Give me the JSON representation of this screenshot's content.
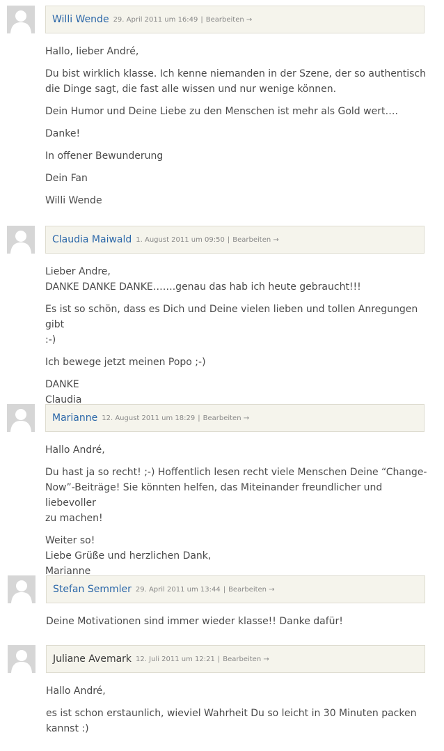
{
  "edit_label": "Bearbeiten →",
  "separator": "|",
  "comments": [
    {
      "author": "Willi Wende",
      "date": "29. April 2011 um 16:49",
      "paragraphs": [
        [
          "Hallo, lieber André,"
        ],
        [
          "Du bist wirklich klasse. Ich kenne niemanden in der Szene, der so authentisch",
          "die Dinge sagt, die fast alle wissen und nur wenige können."
        ],
        [
          "Dein Humor und Deine Liebe zu den Menschen ist mehr als Gold wert…."
        ],
        [
          "Danke!"
        ],
        [
          "In offener Bewunderung"
        ],
        [
          "Dein Fan"
        ],
        [
          "Willi Wende"
        ]
      ]
    },
    {
      "author": "Claudia Maiwald",
      "date": "1. August 2011 um 09:50",
      "paragraphs": [
        [
          "Lieber Andre,",
          "DANKE DANKE DANKE…….genau das hab ich heute gebraucht!!!"
        ],
        [
          "Es ist so schön, dass es Dich und Deine vielen lieben und tollen Anregungen gibt",
          ":-)"
        ],
        [
          "Ich bewege jetzt meinen Popo ;-)"
        ],
        [
          "DANKE",
          "Claudia"
        ]
      ]
    },
    {
      "author": "Marianne",
      "date": "12. August 2011 um 18:29",
      "paragraphs": [
        [
          "Hallo André,"
        ],
        [
          "Du hast ja so recht! ;-) Hoffentlich lesen recht viele Menschen Deine “Change-",
          "Now”-Beiträge! Sie könnten helfen, das Miteinander freundlicher und liebevoller",
          "zu machen!"
        ],
        [
          "Weiter so!",
          "Liebe Grüße und herzlichen Dank,",
          "Marianne"
        ]
      ]
    },
    {
      "author": "Stefan Semmler",
      "date": "29. April 2011 um 13:44",
      "paragraphs": [
        [
          "Deine Motivationen sind immer wieder klasse!! Danke dafür!"
        ]
      ]
    },
    {
      "author": "Juliane Avemark",
      "date": "12. Juli 2011 um 12:21",
      "paragraphs": [
        [
          "Hallo André,"
        ],
        [
          "es ist schon erstaunlich, wieviel Wahrheit Du so leicht in 30 Minuten packen",
          "kannst :)"
        ]
      ]
    }
  ]
}
